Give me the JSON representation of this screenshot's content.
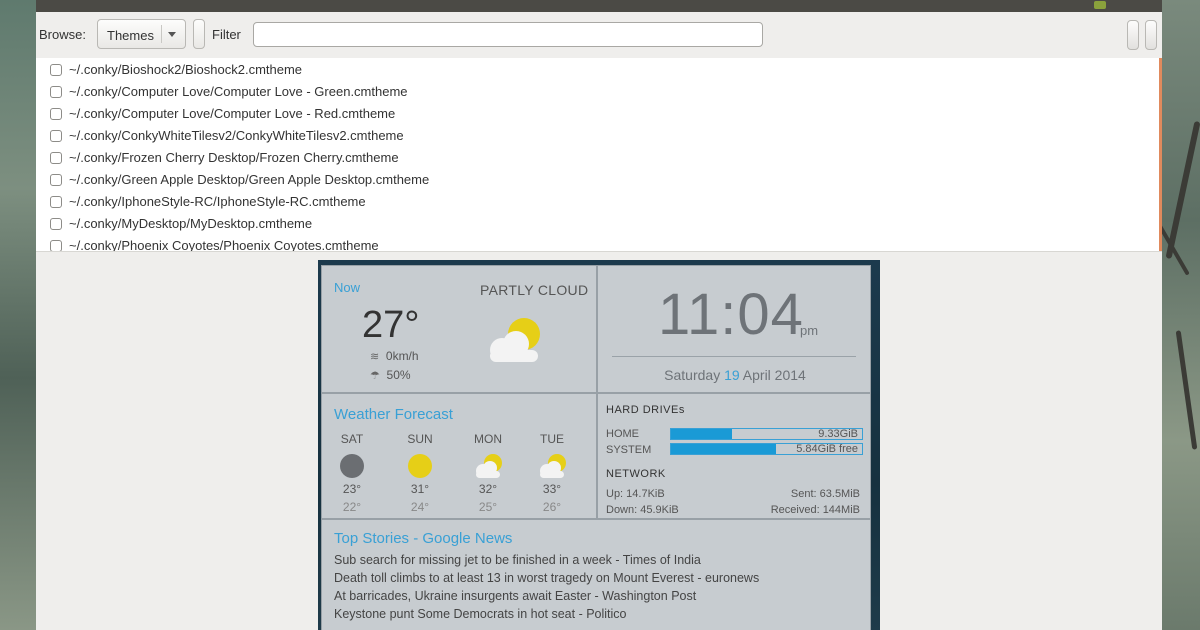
{
  "toolbar": {
    "browse_label": "Browse:",
    "browse_value": "Themes",
    "filter_label": "Filter",
    "filter_value": "",
    "filter_placeholder": ""
  },
  "file_list": [
    "~/.conky/Bioshock2/Bioshock2.cmtheme",
    "~/.conky/Computer Love/Computer Love - Green.cmtheme",
    "~/.conky/Computer Love/Computer Love - Red.cmtheme",
    "~/.conky/ConkyWhiteTilesv2/ConkyWhiteTilesv2.cmtheme",
    "~/.conky/Frozen Cherry Desktop/Frozen Cherry.cmtheme",
    "~/.conky/Green Apple Desktop/Green Apple Desktop.cmtheme",
    "~/.conky/IphoneStyle-RC/IphoneStyle-RC.cmtheme",
    "~/.conky/MyDesktop/MyDesktop.cmtheme",
    "~/.conky/Phoenix Coyotes/Phoenix Coyotes.cmtheme"
  ],
  "weather": {
    "now_label": "Now",
    "condition": "PARTLY CLOUD",
    "temperature": "27°",
    "wind": "0km/h",
    "rain": "50%",
    "icons": {
      "wind": "wind-icon",
      "rain": "umbrella-icon",
      "condition": "partly-cloudy-icon"
    }
  },
  "clock": {
    "time": "11:04",
    "ampm": "pm",
    "date_prefix": "Saturday ",
    "date_day": "19",
    "date_suffix": " April 2014"
  },
  "forecast": {
    "title": "Weather Forecast",
    "days": [
      {
        "day": "SAT",
        "high": "23°",
        "low": "22°",
        "icon": "cloudy-icon"
      },
      {
        "day": "SUN",
        "high": "31°",
        "low": "24°",
        "icon": "sunny-icon"
      },
      {
        "day": "MON",
        "high": "32°",
        "low": "25°",
        "icon": "partly-cloudy-icon"
      },
      {
        "day": "TUE",
        "high": "33°",
        "low": "26°",
        "icon": "partly-cloudy-icon"
      }
    ]
  },
  "system": {
    "drives_title": "HARD DRIVEs",
    "home_label": "HOME",
    "home_value": "9.33GiB",
    "home_fill_fraction": 0.32,
    "system_label": "SYSTEM",
    "system_value": "5.84GiB free",
    "system_fill_fraction": 0.55,
    "network_title": "NETWORK",
    "up": "Up: 14.7KiB",
    "down": "Down: 45.9KiB",
    "sent": "Sent: 63.5MiB",
    "received": "Received: 144MiB"
  },
  "news": {
    "title": "Top Stories - Google News",
    "items": [
      "Sub search for missing jet to be finished in a week - Times of India",
      "Death toll climbs to at least 13 in worst tragedy on Mount Everest - euronews",
      "At barricades, Ukraine insurgents await Easter - Washington Post",
      "Keystone punt Some Democrats in hot seat - Politico"
    ]
  },
  "colors": {
    "accent": "#39a0d5",
    "bar_fill": "#1a9ad6",
    "sun": "#e6cf17",
    "cloud_dark": "#6b6e72",
    "list_scroll": "#e08a5d"
  }
}
